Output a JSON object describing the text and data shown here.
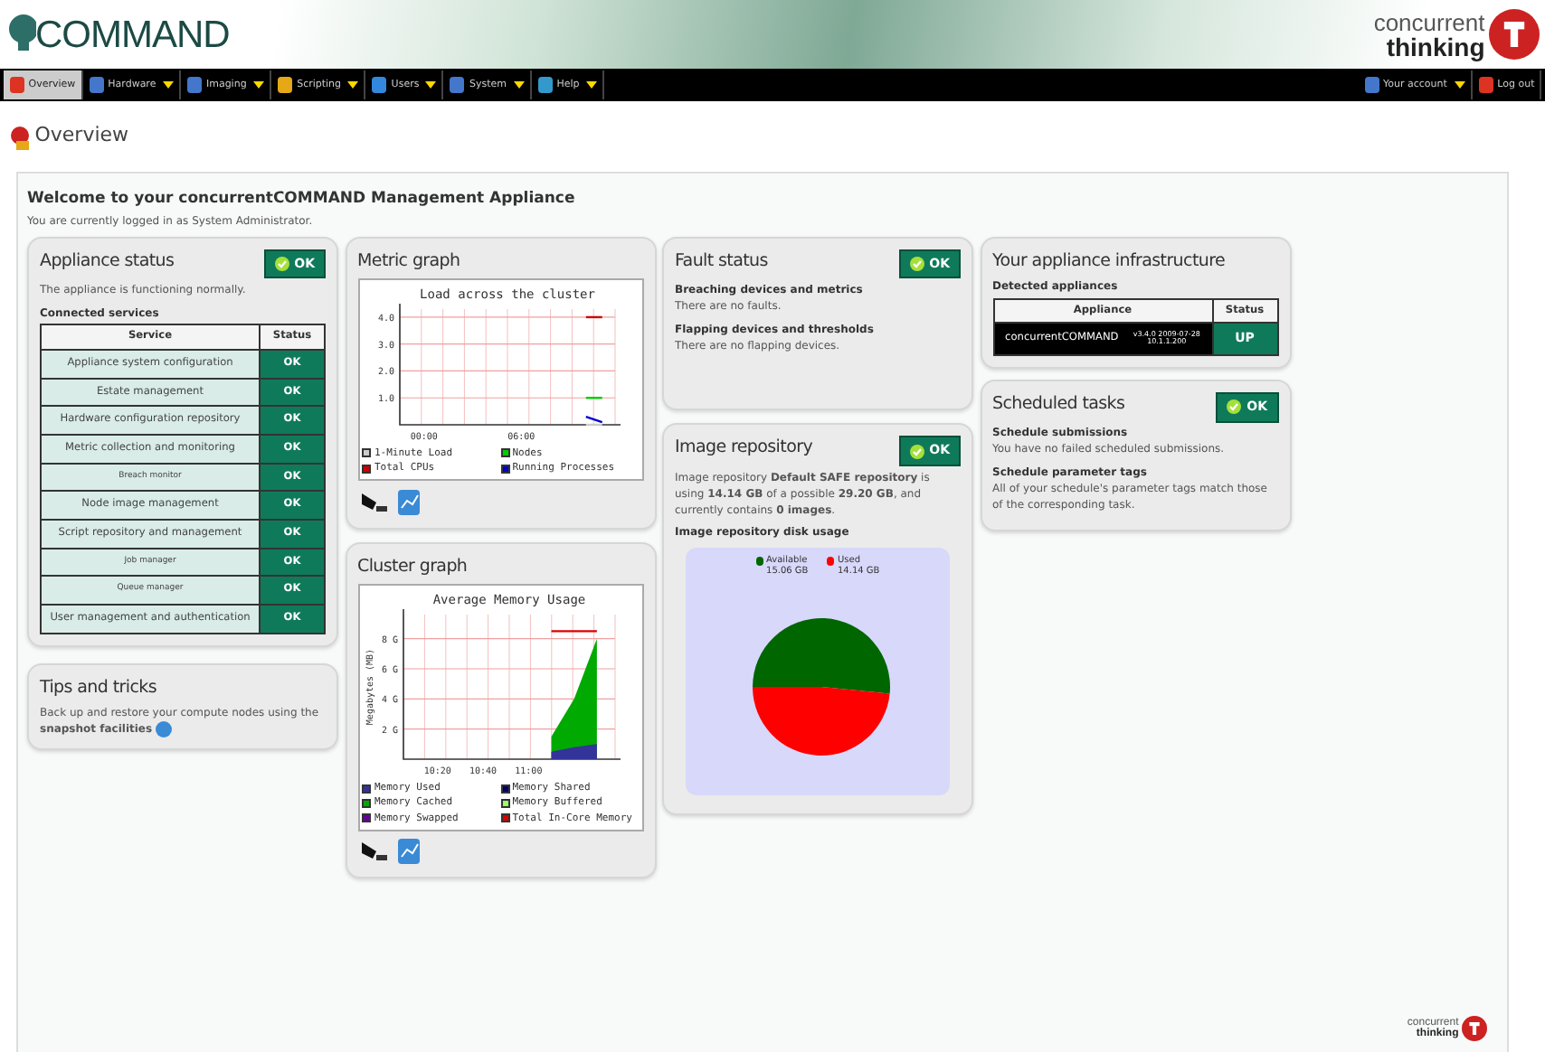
{
  "header": {
    "product": "COMMAND",
    "brand_top": "concurrent",
    "brand_bottom": "thinking"
  },
  "nav": {
    "left": [
      {
        "label": "Overview",
        "selected": true
      },
      {
        "label": "Hardware",
        "selected": false
      },
      {
        "label": "Imaging",
        "selected": false
      },
      {
        "label": "Scripting",
        "selected": false
      },
      {
        "label": "Users",
        "selected": false
      },
      {
        "label": "System",
        "selected": false
      },
      {
        "label": "Help",
        "selected": false
      }
    ],
    "right": [
      {
        "label": "Your account",
        "selected": false
      },
      {
        "label": "Log out",
        "selected": false
      }
    ]
  },
  "page_title": "Overview",
  "welcome": {
    "title": "Welcome to your concurrentCOMMAND Management Appliance",
    "subtitle": "You are currently logged in as System Administrator."
  },
  "appliance_status": {
    "title": "Appliance status",
    "badge": "OK",
    "message": "The appliance is functioning normally.",
    "services_heading": "Connected services",
    "columns": [
      "Service",
      "Status"
    ],
    "rows": [
      {
        "kind": "service",
        "name": "Appliance system configuration",
        "status": "OK"
      },
      {
        "kind": "service",
        "name": "Estate management",
        "status": "OK"
      },
      {
        "kind": "service",
        "name": "Hardware configuration repository",
        "status": "OK"
      },
      {
        "kind": "service",
        "name": "Metric collection and monitoring",
        "status": "OK"
      },
      {
        "kind": "subservice",
        "name": "Breach monitor",
        "status": "OK"
      },
      {
        "kind": "service",
        "name": "Node image management",
        "status": "OK"
      },
      {
        "kind": "service",
        "name": "Script repository and management",
        "status": "OK"
      },
      {
        "kind": "subservice",
        "name": "Job manager",
        "status": "OK"
      },
      {
        "kind": "subservice",
        "name": "Queue manager",
        "status": "OK"
      },
      {
        "kind": "service",
        "name": "User management and authentication",
        "status": "OK"
      }
    ]
  },
  "tips": {
    "title": "Tips and tricks",
    "text": "Back up and restore your compute nodes using the **snapshot facilities**"
  },
  "metric_graph": {
    "title": "Metric graph",
    "chart_data": {
      "type": "line",
      "title": "Load across the cluster",
      "categories": [
        null,
        "00:00",
        null,
        null,
        null,
        null,
        null,
        "06:00",
        null,
        null,
        null,
        null,
        null
      ],
      "ylim": [
        0,
        4.3
      ],
      "grid": true,
      "legend": "bottom",
      "yticks": [
        {
          "value": 1,
          "label": "1.0"
        },
        {
          "value": 2,
          "label": "2.0"
        },
        {
          "value": 3,
          "label": "3.0"
        },
        {
          "value": 4,
          "label": "4.0"
        }
      ],
      "series": [
        {
          "name": "1-Minute Load",
          "color": "#cccccc",
          "values": [
            null,
            null,
            null,
            null,
            null,
            null,
            null,
            null,
            null,
            null,
            null,
            0,
            0
          ]
        },
        {
          "name": "Nodes",
          "color": "#00cc00",
          "values": [
            null,
            null,
            null,
            null,
            null,
            null,
            null,
            null,
            null,
            null,
            null,
            1,
            1
          ]
        },
        {
          "name": "Total CPUs",
          "color": "#cc0000",
          "values": [
            null,
            null,
            null,
            null,
            null,
            null,
            null,
            null,
            null,
            null,
            null,
            4,
            4
          ]
        },
        {
          "name": "Running Processes",
          "color": "#0000cc",
          "values": [
            null,
            null,
            null,
            null,
            null,
            null,
            null,
            null,
            null,
            null,
            null,
            0.3,
            0.1
          ]
        }
      ]
    }
  },
  "cluster_graph": {
    "title": "Cluster graph",
    "chart_data": {
      "type": "area",
      "title": "Average Memory Usage",
      "ylabel": "Megabytes (MB)",
      "categories": [
        null,
        "10:20",
        null,
        "10:40",
        null,
        "11:00",
        null,
        null,
        null
      ],
      "ylim": [
        0,
        9.6
      ],
      "grid": true,
      "legend": "bottom",
      "yticks": [
        {
          "value": 2,
          "label": "2 G"
        },
        {
          "value": 4,
          "label": "4 G"
        },
        {
          "value": 6,
          "label": "6 G"
        },
        {
          "value": 8,
          "label": "8 G"
        }
      ],
      "series": [
        {
          "name": "Memory Used",
          "color": "#333399",
          "values": [
            null,
            null,
            null,
            null,
            null,
            null,
            0.5,
            0.8,
            1
          ]
        },
        {
          "name": "Memory Shared",
          "color": "#000066",
          "values": [
            null,
            null,
            null,
            null,
            null,
            null,
            null,
            null,
            null
          ]
        },
        {
          "name": "Memory Cached",
          "color": "#00aa00",
          "values": [
            null,
            null,
            null,
            null,
            null,
            null,
            1.5,
            4,
            8
          ]
        },
        {
          "name": "Memory Buffered",
          "color": "#99ff66",
          "values": [
            null,
            null,
            null,
            null,
            null,
            null,
            null,
            null,
            null
          ]
        },
        {
          "name": "Memory Swapped",
          "color": "#660099",
          "values": [
            null,
            null,
            null,
            null,
            null,
            null,
            null,
            null,
            null
          ]
        },
        {
          "name": "Total In-Core Memory",
          "type": "line",
          "color": "#dd0000",
          "values": [
            null,
            null,
            null,
            null,
            null,
            null,
            8.5,
            8.5,
            8.5
          ]
        }
      ]
    }
  },
  "fault_status": {
    "title": "Fault status",
    "badge": "OK",
    "sections": [
      {
        "heading": "Breaching devices and metrics",
        "text": "There are no faults."
      },
      {
        "heading": "Flapping devices and thresholds",
        "text": "There are no flapping devices."
      }
    ]
  },
  "image_repository": {
    "title": "Image repository",
    "badge": "OK",
    "text": "Image repository **Default SAFE repository** is using **14.14 GB** of a possible **29.20 GB**, and currently contains **0 images**.",
    "chart_heading": "Image repository disk usage",
    "chart_data": {
      "type": "pie",
      "legend": "top",
      "categories": [
        "Available",
        "Used"
      ],
      "values": [
        15.06,
        14.14
      ],
      "colors": [
        "#006600",
        "#ff0000"
      ],
      "value_labels": [
        "15.06 GB",
        "14.14 GB"
      ]
    }
  },
  "infrastructure": {
    "title": "Your appliance infrastructure",
    "heading": "Detected appliances",
    "columns": [
      "Appliance",
      "Status"
    ],
    "rows": [
      {
        "name": "concurrentCOMMAND",
        "detail": "v3.4.0 2009-07-28",
        "address": "10.1.1.200",
        "status": "UP"
      }
    ]
  },
  "scheduled_tasks": {
    "title": "Scheduled tasks",
    "badge": "OK",
    "sections": [
      {
        "heading": "Schedule submissions",
        "text": "You have no failed scheduled submissions."
      },
      {
        "heading": "Schedule parameter tags",
        "text": "All of your schedule's parameter tags match those of the corresponding task."
      }
    ]
  },
  "footer": {
    "brand_top": "concurrent",
    "brand_bottom": "thinking"
  }
}
